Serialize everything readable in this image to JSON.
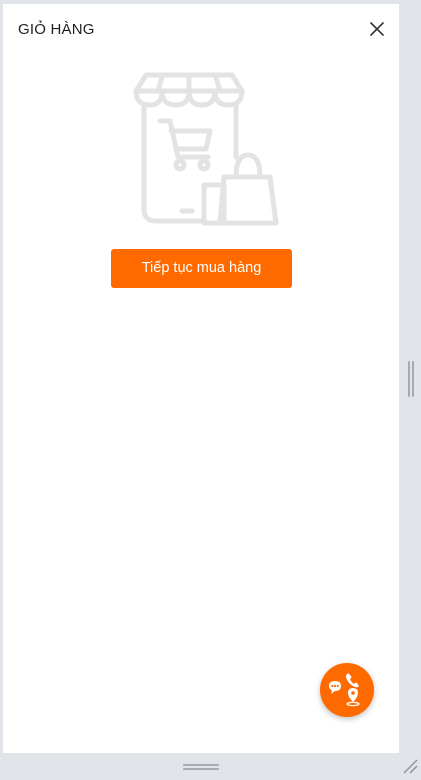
{
  "cart": {
    "title": "GIỎ HÀNG",
    "continue_label": "Tiếp tục mua hàng"
  },
  "icons": {
    "close": "close-icon",
    "empty_state": "shop-cart-bag-icon",
    "fab": "contact-phone-chat-location-icon"
  },
  "colors": {
    "accent": "#ff6a00",
    "illustration": "#e3e3e3",
    "panel_bg": "#ffffff",
    "frame_bg": "#e1e4e8"
  }
}
